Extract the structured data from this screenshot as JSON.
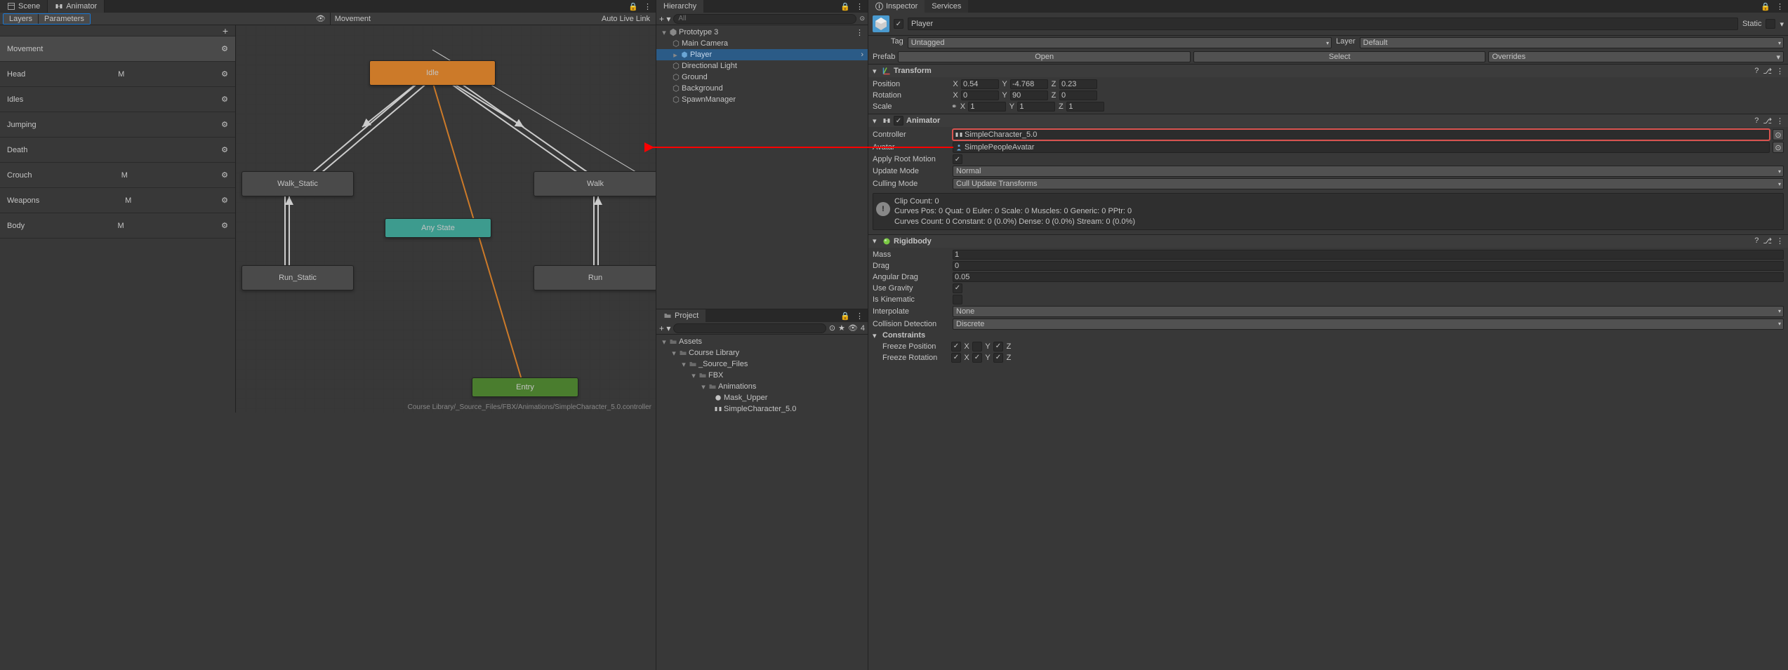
{
  "tabs": {
    "scene": "Scene",
    "animator": "Animator"
  },
  "subheader": {
    "layers": "Layers",
    "parameters": "Parameters",
    "breadcrumb": "Movement",
    "auto_live": "Auto Live Link"
  },
  "layers": [
    {
      "name": "Movement",
      "m": false
    },
    {
      "name": "Head",
      "m": true
    },
    {
      "name": "Idles",
      "m": false
    },
    {
      "name": "Jumping",
      "m": false
    },
    {
      "name": "Death",
      "m": false
    },
    {
      "name": "Crouch",
      "m": true
    },
    {
      "name": "Weapons",
      "m": true
    },
    {
      "name": "Body",
      "m": true
    }
  ],
  "graph": {
    "idle": "Idle",
    "walk_static": "Walk_Static",
    "walk": "Walk",
    "run_static": "Run_Static",
    "run": "Run",
    "any_state": "Any State",
    "entry": "Entry",
    "path": "Course Library/_Source_Files/FBX/Animations/SimpleCharacter_5.0.controller"
  },
  "hierarchy": {
    "title": "Hierarchy",
    "search_placeholder": "All",
    "items": [
      {
        "name": "Prototype 3",
        "depth": 0,
        "icon": "unity",
        "expanded": true
      },
      {
        "name": "Main Camera",
        "depth": 1,
        "icon": "cube"
      },
      {
        "name": "Player",
        "depth": 1,
        "icon": "prefab",
        "selected": true
      },
      {
        "name": "Directional Light",
        "depth": 1,
        "icon": "cube"
      },
      {
        "name": "Ground",
        "depth": 1,
        "icon": "cube"
      },
      {
        "name": "Background",
        "depth": 1,
        "icon": "cube"
      },
      {
        "name": "SpawnManager",
        "depth": 1,
        "icon": "cube"
      }
    ]
  },
  "project": {
    "title": "Project",
    "search_placeholder": "",
    "visible_count": "4",
    "items": [
      {
        "name": "Assets",
        "depth": 0,
        "expanded": true
      },
      {
        "name": "Course Library",
        "depth": 1,
        "expanded": true
      },
      {
        "name": "_Source_Files",
        "depth": 2,
        "expanded": true
      },
      {
        "name": "FBX",
        "depth": 3,
        "expanded": true
      },
      {
        "name": "Animations",
        "depth": 4,
        "expanded": true
      },
      {
        "name": "Mask_Upper",
        "depth": 5
      },
      {
        "name": "SimpleCharacter_5.0",
        "depth": 5
      }
    ]
  },
  "inspector": {
    "title": "Inspector",
    "services": "Services",
    "object_name": "Player",
    "static": "Static",
    "tag_label": "Tag",
    "tag_value": "Untagged",
    "layer_label": "Layer",
    "layer_value": "Default",
    "prefab_label": "Prefab",
    "prefab_open": "Open",
    "prefab_select": "Select",
    "prefab_overrides": "Overrides",
    "transform": {
      "title": "Transform",
      "position": "Position",
      "px": "0.54",
      "py": "-4.768",
      "pz": "0.23",
      "rotation": "Rotation",
      "rx": "0",
      "ry": "90",
      "rz": "0",
      "scale": "Scale",
      "sx": "1",
      "sy": "1",
      "sz": "1"
    },
    "animator": {
      "title": "Animator",
      "controller_label": "Controller",
      "controller_value": "SimpleCharacter_5.0",
      "avatar_label": "Avatar",
      "avatar_value": "SimplePeopleAvatar",
      "root_motion_label": "Apply Root Motion",
      "update_mode_label": "Update Mode",
      "update_mode_value": "Normal",
      "culling_mode_label": "Culling Mode",
      "culling_mode_value": "Cull Update Transforms",
      "info": "Clip Count: 0\nCurves Pos: 0 Quat: 0 Euler: 0 Scale: 0 Muscles: 0 Generic: 0 PPtr: 0\nCurves Count: 0 Constant: 0 (0.0%) Dense: 0 (0.0%) Stream: 0 (0.0%)"
    },
    "rigidbody": {
      "title": "Rigidbody",
      "mass_label": "Mass",
      "mass": "1",
      "drag_label": "Drag",
      "drag": "0",
      "ang_drag_label": "Angular Drag",
      "ang_drag": "0.05",
      "use_gravity_label": "Use Gravity",
      "is_kinematic_label": "Is Kinematic",
      "interpolate_label": "Interpolate",
      "interpolate_value": "None",
      "collision_label": "Collision Detection",
      "collision_value": "Discrete",
      "constraints_label": "Constraints",
      "freeze_pos_label": "Freeze Position",
      "freeze_rot_label": "Freeze Rotation"
    }
  }
}
